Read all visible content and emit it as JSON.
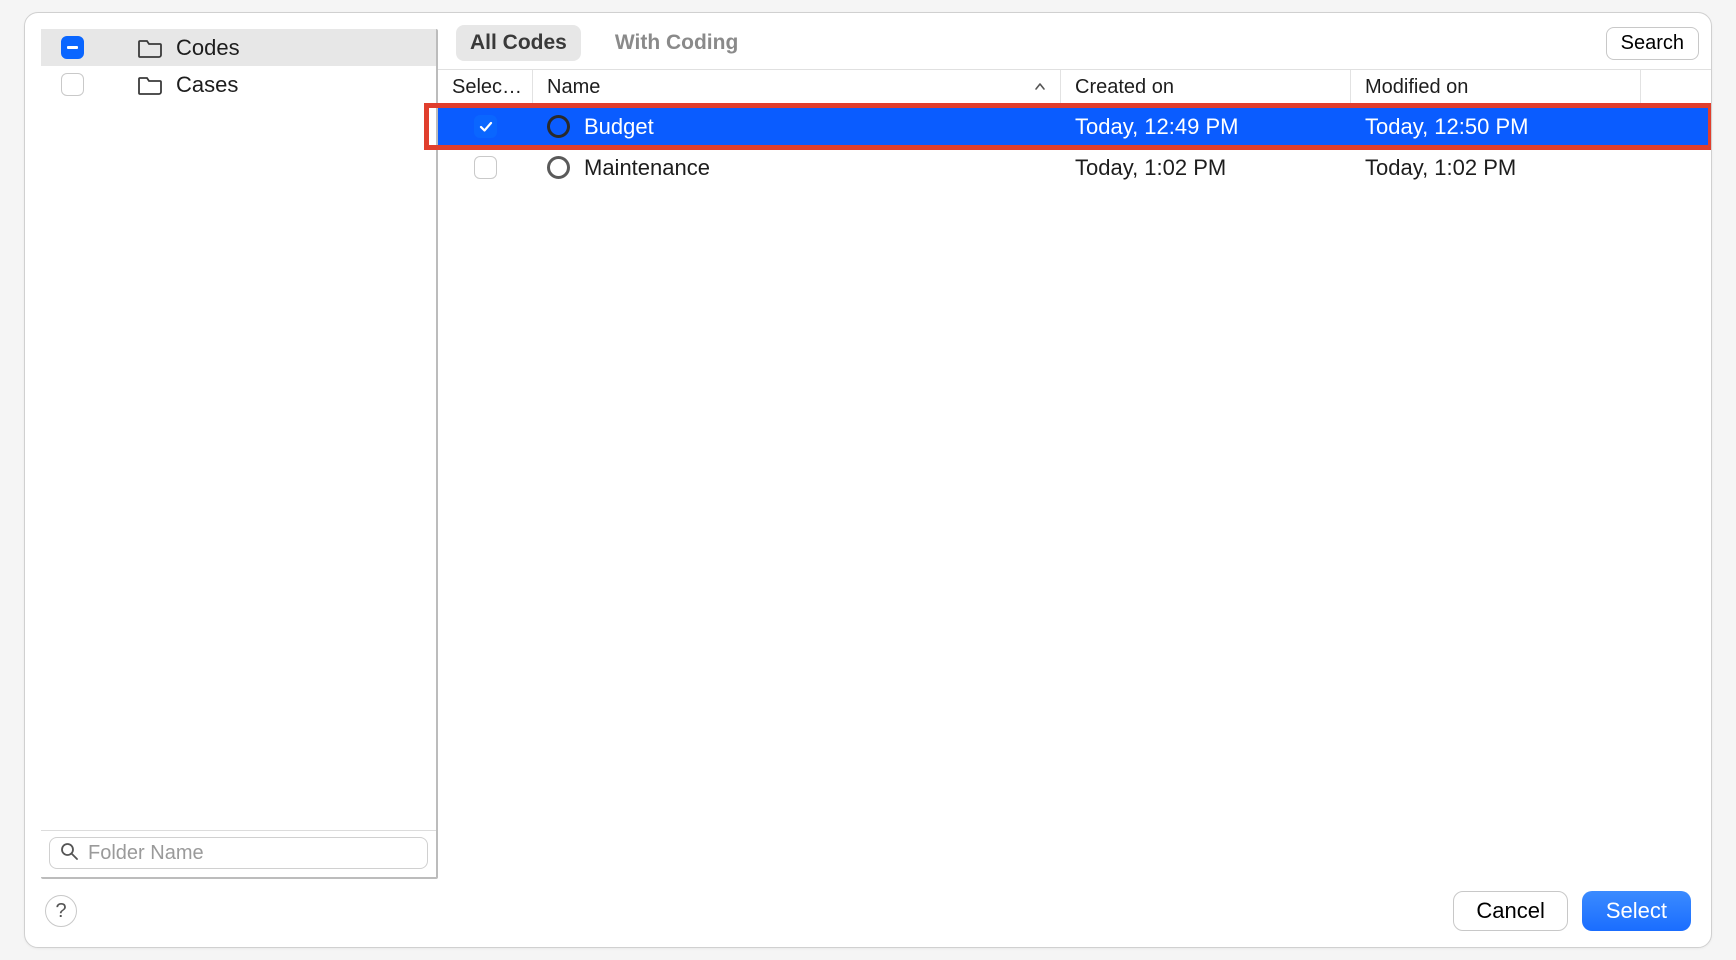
{
  "sidebar": {
    "items": [
      {
        "label": "Codes",
        "checked": "indeterminate",
        "selected": true
      },
      {
        "label": "Cases",
        "checked": "unchecked",
        "selected": false
      }
    ],
    "search_placeholder": "Folder Name"
  },
  "toolbar": {
    "tabs": [
      {
        "label": "All Codes",
        "active": true
      },
      {
        "label": "With Coding",
        "active": false
      }
    ],
    "search_label": "Search"
  },
  "columns": {
    "select": "Selec…",
    "name": "Name",
    "created": "Created on",
    "modified": "Modified on"
  },
  "rows": [
    {
      "checked": true,
      "selected": true,
      "highlighted": true,
      "name": "Budget",
      "created": "Today, 12:49 PM",
      "modified": "Today, 12:50 PM"
    },
    {
      "checked": false,
      "selected": false,
      "highlighted": false,
      "name": "Maintenance",
      "created": "Today, 1:02 PM",
      "modified": "Today, 1:02 PM"
    }
  ],
  "footer": {
    "cancel": "Cancel",
    "select": "Select"
  }
}
